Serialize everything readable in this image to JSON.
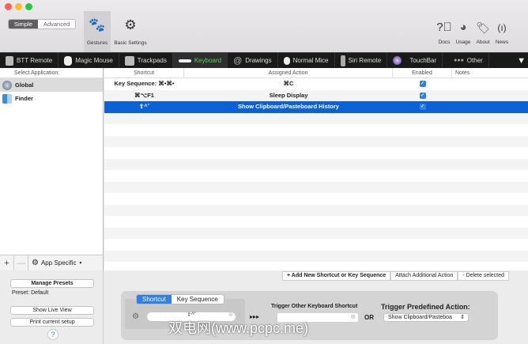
{
  "toolbar": {
    "mode_simple": "Simple",
    "mode_advanced": "Advanced",
    "gestures": "Gestures",
    "basic_settings": "Basic Settings",
    "docs": "Docs",
    "usage": "Usage",
    "about": "About",
    "news": "News"
  },
  "tabs": [
    {
      "label": "BTT Remote"
    },
    {
      "label": "Magic Mouse"
    },
    {
      "label": "Trackpads"
    },
    {
      "label": "Keyboard",
      "selected": true
    },
    {
      "label": "Drawings"
    },
    {
      "label": "Normal Mice"
    },
    {
      "label": "Siri Remote"
    },
    {
      "label": "TouchBar"
    },
    {
      "label": "Other"
    }
  ],
  "sidebar": {
    "header": "Select Application:",
    "apps": [
      {
        "name": "Global",
        "selected": true
      },
      {
        "name": "Finder"
      }
    ],
    "add": "+",
    "remove": "—",
    "app_specific": "App Specific"
  },
  "table": {
    "columns": [
      "Shortcut",
      "Assigned Action",
      "Enabled",
      "Notes"
    ],
    "rows": [
      {
        "shortcut": "Key Sequence: ⌘•⌘•",
        "action": "⌘C",
        "enabled": true,
        "notes": ""
      },
      {
        "shortcut": "⌘⌥F1",
        "action": "Sleep Display",
        "enabled": true,
        "notes": ""
      },
      {
        "shortcut": "⇧^ˇ",
        "action": "Show Clipboard/Pasteboard History",
        "enabled": true,
        "notes": "",
        "selected": true
      }
    ]
  },
  "table_buttons": {
    "add": "+ Add New Shortcut or Key Sequence",
    "attach": "Attach Additional Action",
    "delete": "- Delete selected"
  },
  "left_panel": {
    "manage_presets": "Manage Presets",
    "preset": "Preset: Default",
    "live_view": "Show Live View",
    "print": "Print current setup",
    "help": "?"
  },
  "editor": {
    "tab_shortcut": "Shortcut",
    "tab_sequence": "Key Sequence",
    "shortcut_value": "⇧^ˇ",
    "arrows": "▸▸▸",
    "trigger_other": "Trigger Other Keyboard Shortcut",
    "or": "OR",
    "trigger_predefined": "Trigger Predefined Action:",
    "predefined_value": "Show Clipboard/Pasteboa"
  },
  "watermark": "双电网(www.pcpc.me)",
  "colors": {
    "selection": "#0b62d6",
    "active_tab": "#4ed34e",
    "tabbar": "#1a1a1a"
  }
}
